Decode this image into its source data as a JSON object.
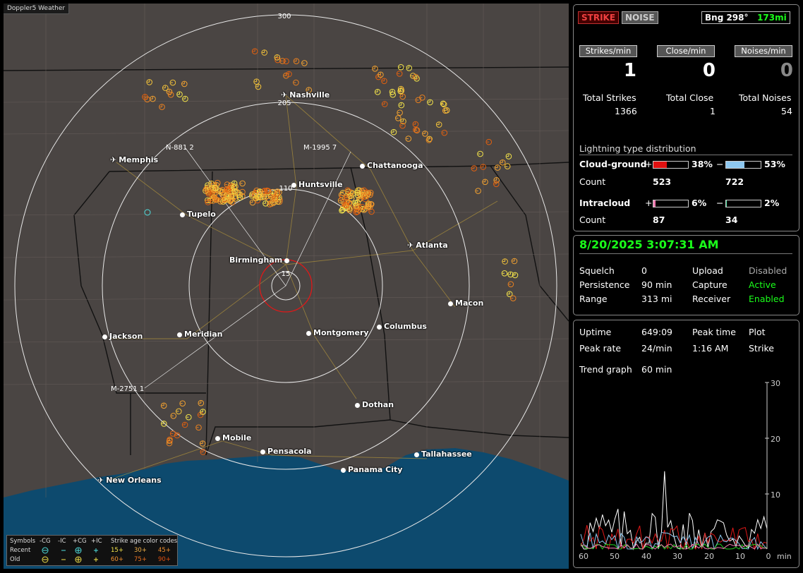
{
  "app_title": "Doppler5 Weather",
  "map": {
    "range_labels": [
      "300",
      "205",
      "110",
      "15"
    ],
    "cities": [
      {
        "name": "Nashville",
        "airport": true
      },
      {
        "name": "Memphis",
        "airport": true
      },
      {
        "name": "Chattanooga",
        "airport": false
      },
      {
        "name": "Huntsville",
        "airport": false
      },
      {
        "name": "Tupelo",
        "airport": false
      },
      {
        "name": "Atlanta",
        "airport": true
      },
      {
        "name": "Birmingham",
        "airport": false
      },
      {
        "name": "Macon",
        "airport": false
      },
      {
        "name": "Jackson",
        "airport": false
      },
      {
        "name": "Meridian",
        "airport": false
      },
      {
        "name": "Montgomery",
        "airport": false
      },
      {
        "name": "Columbus",
        "airport": false
      },
      {
        "name": "Dothan",
        "airport": false
      },
      {
        "name": "Mobile",
        "airport": false
      },
      {
        "name": "Pensacola",
        "airport": false
      },
      {
        "name": "Tallahassee",
        "airport": false
      },
      {
        "name": "Panama City",
        "airport": false
      },
      {
        "name": "New Orleans",
        "airport": true
      }
    ],
    "storm_cells": [
      "N-881 2",
      "M-1995 7",
      "M-2751 1"
    ],
    "legend": {
      "symbols_label": "Symbols",
      "headers": [
        "-CG",
        "-IC",
        "+CG",
        "+IC"
      ],
      "age_title": "Strike age color codes",
      "recent_label": "Recent",
      "old_label": "Old",
      "recent_ages": [
        "15+",
        "30+",
        "45+"
      ],
      "old_ages": [
        "60+",
        "75+",
        "90+"
      ]
    }
  },
  "top_panel": {
    "strike_tab": "STRIKE",
    "noise_tab": "NOISE",
    "bearing": "Bng 298°",
    "distance": "173mi",
    "strikes_min_label": "Strikes/min",
    "close_min_label": "Close/min",
    "noises_min_label": "Noises/min",
    "strikes_min": "1",
    "close_min": "0",
    "noises_min": "0",
    "total_strikes_label": "Total Strikes",
    "total_close_label": "Total Close",
    "total_noises_label": "Total Noises",
    "total_strikes": "1366",
    "total_close": "1",
    "total_noises": "54",
    "dist_title": "Lightning type distribution",
    "cg_label": "Cloud-ground",
    "ic_label": "Intracloud",
    "count_label": "Count",
    "plus": "+",
    "minus": "−",
    "cg_pos_pct": "38%",
    "cg_neg_pct": "53%",
    "cg_pos_count": "523",
    "cg_neg_count": "722",
    "ic_pos_pct": "6%",
    "ic_neg_pct": "2%",
    "ic_pos_count": "87",
    "ic_neg_count": "34",
    "cg_pos_frac": 0.38,
    "cg_neg_frac": 0.53,
    "ic_pos_frac": 0.06,
    "ic_neg_frac": 0.02
  },
  "status_panel": {
    "datetime": "8/20/2025 3:07:31 AM",
    "squelch_label": "Squelch",
    "squelch": "0",
    "persistence_label": "Persistence",
    "persistence": "90 min",
    "range_label": "Range",
    "range": "313 mi",
    "upload_label": "Upload",
    "upload": "Disabled",
    "capture_label": "Capture",
    "capture": "Active",
    "receiver_label": "Receiver",
    "receiver": "Enabled"
  },
  "trend_panel": {
    "uptime_label": "Uptime",
    "uptime": "649:09",
    "peak_time_label": "Peak time",
    "peak_time": "1:16 AM",
    "plot_label": "Plot",
    "plot": "Strike",
    "peak_rate_label": "Peak rate",
    "peak_rate": "24/min",
    "trend_label": "Trend graph",
    "trend": "60 min",
    "y_ticks": [
      "30",
      "20",
      "10"
    ],
    "x_ticks": [
      "60",
      "50",
      "40",
      "30",
      "20",
      "10",
      "0"
    ],
    "x_unit": "min"
  },
  "colors": {
    "accent_green": "#1aff1a",
    "strike_red": "#d01010",
    "noise_blue": "#8ec8f0"
  }
}
